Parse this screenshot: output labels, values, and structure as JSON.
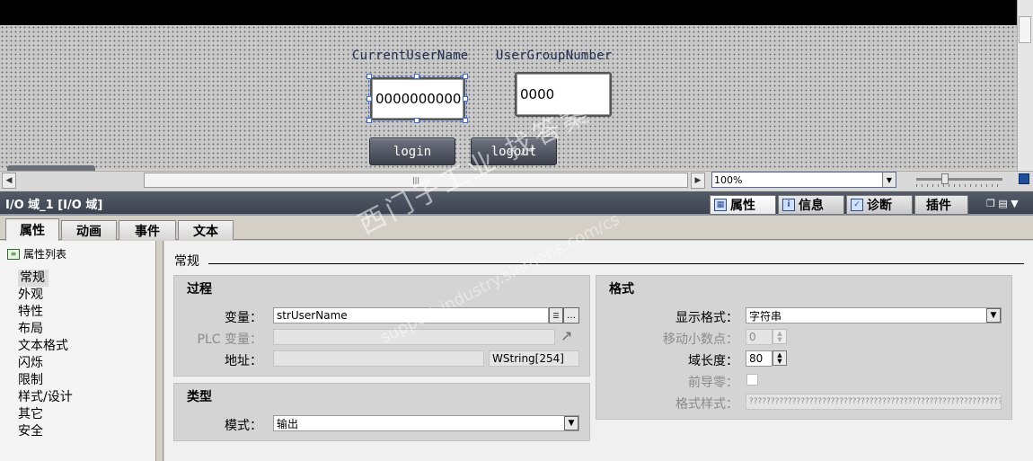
{
  "canvas": {
    "label_user": "CurrentUserName",
    "label_group": "UserGroupNumber",
    "io_user_value": "0000000000",
    "io_group_value": "0000",
    "btn_login": "login",
    "btn_logout": "logout"
  },
  "toolbar": {
    "zoom_value": "100%"
  },
  "inspector": {
    "title": "I/O 域_1 [I/O 域]",
    "tabs": [
      {
        "label": "属性"
      },
      {
        "label": "信息"
      },
      {
        "label": "诊断"
      },
      {
        "label": "插件"
      }
    ],
    "subtabs": [
      {
        "label": "属性"
      },
      {
        "label": "动画"
      },
      {
        "label": "事件"
      },
      {
        "label": "文本"
      }
    ]
  },
  "property_list": {
    "header": "属性列表",
    "items": [
      "常规",
      "外观",
      "特性",
      "布局",
      "文本格式",
      "闪烁",
      "限制",
      "样式/设计",
      "其它",
      "安全"
    ],
    "selected": "常规"
  },
  "general": {
    "section_title": "常规",
    "process": {
      "title": "过程",
      "variable_label": "变量：",
      "variable_value": "strUserName",
      "plc_label": "PLC 变量：",
      "address_label": "地址：",
      "address_type": "WString[254]"
    },
    "type": {
      "title": "类型",
      "mode_label": "模式：",
      "mode_value": "输出"
    },
    "format": {
      "title": "格式",
      "display_format_label": "显示格式：",
      "display_format_value": "字符串",
      "move_decimal_label": "移动小数点：",
      "move_decimal_value": "0",
      "field_length_label": "域长度：",
      "field_length_value": "80",
      "leading_zero_label": "前导零：",
      "format_pattern_label": "格式样式：",
      "format_pattern_value": "????????????????????????????????????????????????????????????????????????????????"
    }
  },
  "watermark": {
    "line1": "西门子工业 找答案",
    "line2": "support.industry.siemens.com/cs"
  }
}
